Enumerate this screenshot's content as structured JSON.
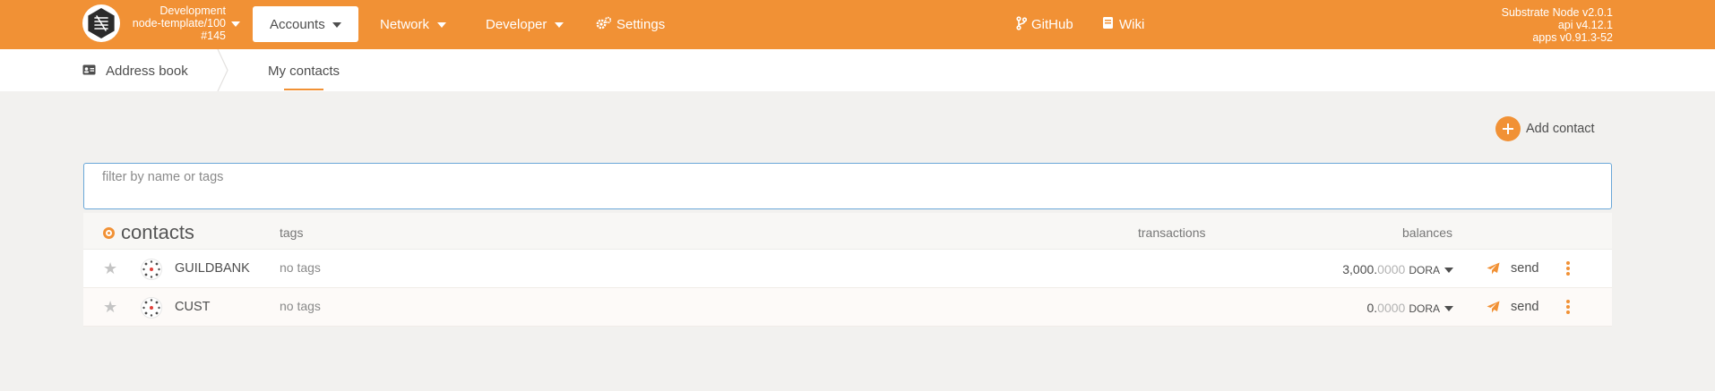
{
  "header": {
    "chain": {
      "line1": "Development",
      "line2": "node-template/100",
      "line3": "#145"
    },
    "nav": {
      "accounts": "Accounts",
      "network": "Network",
      "developer": "Developer",
      "settings": "Settings",
      "github": "GitHub",
      "wiki": "Wiki"
    },
    "version": {
      "line1": "Substrate Node v2.0.1",
      "line2": "api v4.12.1",
      "line3": "apps v0.91.3-52"
    }
  },
  "subnav": {
    "address_book": "Address book",
    "my_contacts": "My contacts"
  },
  "actions": {
    "add_contact": "Add contact"
  },
  "filter": {
    "placeholder": "filter by name or tags",
    "value": ""
  },
  "table": {
    "title": "contacts",
    "columns": {
      "tags": "tags",
      "transactions": "transactions",
      "balances": "balances"
    },
    "rows": [
      {
        "name": "GUILDBANK",
        "tags": "no tags",
        "balance_int": "3,000.",
        "balance_dec": "0000",
        "unit": "DORA",
        "send": "send"
      },
      {
        "name": "CUST",
        "tags": "no tags",
        "balance_int": "0.",
        "balance_dec": "0000",
        "unit": "DORA",
        "send": "send"
      }
    ]
  },
  "colors": {
    "accent": "#f19135",
    "background": "#f2f1ef",
    "text": "#4e4e4e"
  }
}
